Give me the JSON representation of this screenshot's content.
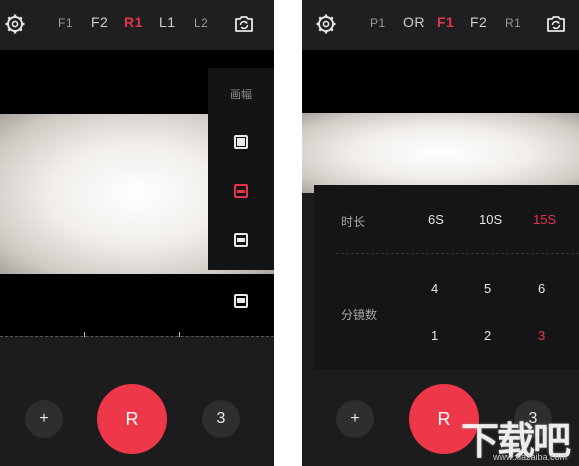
{
  "left": {
    "tabs": [
      {
        "label": "F1"
      },
      {
        "label": "F2"
      },
      {
        "label": "R1"
      },
      {
        "label": "L1"
      },
      {
        "label": "L2"
      }
    ],
    "active_tab": "R1",
    "aspect_panel": {
      "title": "画幅",
      "options": [
        "1:1",
        "2.35:1",
        "16:9",
        "4:3"
      ],
      "selected": "2.35:1"
    },
    "add_label": "+",
    "record_label": "R",
    "count_label": "3"
  },
  "right": {
    "tabs": [
      {
        "label": "P1"
      },
      {
        "label": "OR"
      },
      {
        "label": "F1"
      },
      {
        "label": "F2"
      },
      {
        "label": "R1"
      }
    ],
    "active_tab": "F1",
    "settings": {
      "duration_label": "时长",
      "durations": [
        "6S",
        "10S",
        "15S"
      ],
      "duration_selected": "15S",
      "shots_label": "分镜数",
      "shots_row1": [
        "4",
        "5",
        "6"
      ],
      "shots_row2": [
        "1",
        "2",
        "3"
      ],
      "shots_selected": "3"
    },
    "add_label": "+",
    "record_label": "R",
    "count_label": "3"
  },
  "watermark": {
    "brand": "下载吧",
    "url": "www.xiazaiba.com"
  },
  "colors": {
    "accent": "#e8334a",
    "record": "#ee3748",
    "background": "#1c1c1e"
  },
  "icons": [
    "settings-gear-icon",
    "camera-switch-icon",
    "aspect-ratio-icon"
  ]
}
